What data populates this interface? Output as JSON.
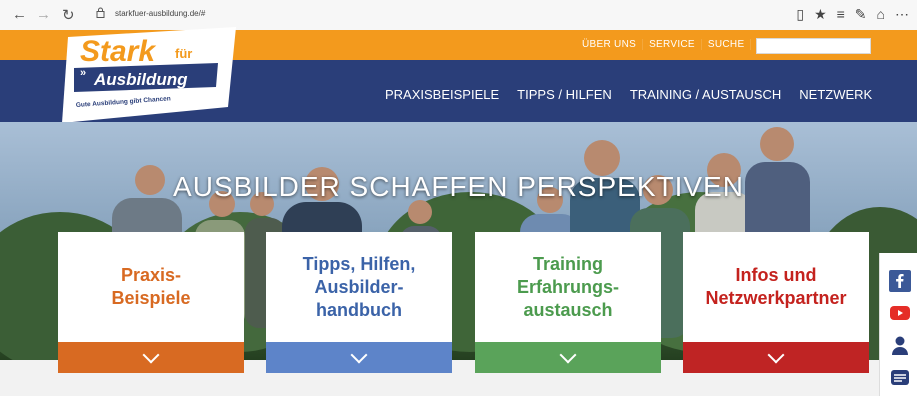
{
  "browser": {
    "url": "starkfuer-ausbildung.de/#"
  },
  "logo": {
    "line1": "Stark",
    "line1b": "für",
    "line2": "Ausbildung",
    "tagline": "Gute Ausbildung gibt Chancen"
  },
  "utility_nav": [
    "ÜBER UNS",
    "SERVICE",
    "SUCHE"
  ],
  "main_nav": [
    "PRAXISBEISPIELE",
    "TIPPS / HILFEN",
    "TRAINING / AUSTAUSCH",
    "NETZWERK"
  ],
  "hero": {
    "title": "AUSBILDER SCHAFFEN PERSPEKTIVEN"
  },
  "cards": [
    {
      "title": "Praxis-\nBeispiele",
      "title_color": "#d86a22",
      "bar_color": "#d86a22"
    },
    {
      "title": "Tipps, Hilfen,\nAusbilder-\nhandbuch",
      "title_color": "#3b63a8",
      "bar_color": "#5d84c9"
    },
    {
      "title": "Training\nErfahrungs-\naustausch",
      "title_color": "#4c9b4e",
      "bar_color": "#5aa35a"
    },
    {
      "title": "Infos und\nNetzwerkpartner",
      "title_color": "#c4221e",
      "bar_color": "#bf2424"
    }
  ],
  "social": [
    "facebook-icon",
    "youtube-icon",
    "user-icon",
    "mail-icon"
  ]
}
